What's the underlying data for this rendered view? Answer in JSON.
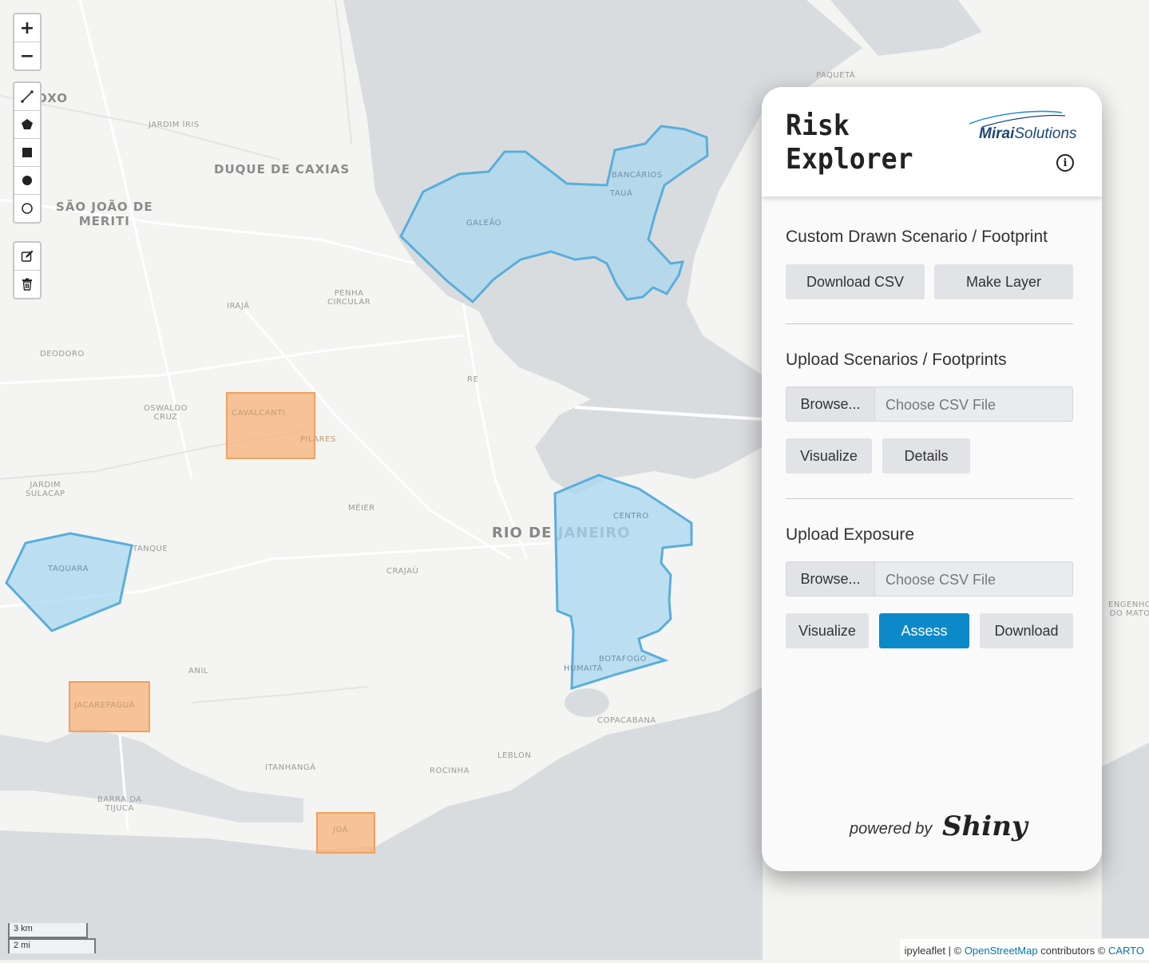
{
  "map": {
    "zoom_in": "+",
    "zoom_out": "−",
    "draw_tools": [
      "polyline-icon",
      "polygon-icon",
      "rectangle-icon",
      "circle-marker-icon",
      "circle-icon"
    ],
    "edit_tools": [
      "edit-icon",
      "trash-icon"
    ],
    "scale_km": "3 km",
    "scale_mi": "2 mi",
    "attribution": {
      "prefix": "ipyleaflet",
      "sep": "|",
      "copy1": "©",
      "osm": "OpenStreetMap",
      "contributors": "contributors ©",
      "carto": "CARTO"
    },
    "places": {
      "paqueta": "PAQUETÁ",
      "jardim_iris": "JARDIM ÍRIS",
      "duque": "DUQUE DE CAXIAS",
      "sjm": "SÃO JOÃO DE\nMERITI",
      "galeao": "GALEÃO",
      "bancarios": "BANCÁRIOS",
      "taua": "TAUÁ",
      "iraja": "IRAJÁ",
      "penha": "PENHA\nCIRCULAR",
      "deodoro": "DEODORO",
      "oswaldo": "OSWALDO\nCRUZ",
      "cavalcanti": "CAVALCANTI",
      "pilares": "PILARES",
      "re": "RE",
      "jardim_sulacap": "JARDIM\nSULACAP",
      "meier": "MÉIER",
      "rio": "RIO DE JANEIRO",
      "centro": "CENTRO",
      "tanque": "TANQUE",
      "taquara": "TAQUARA",
      "jacarepagua": "JACAREPAGUÁ",
      "anil": "ANIL",
      "crajau": "CRAJAÚ",
      "botafogo": "BOTAFOGO",
      "humaita": "HUMAITÁ",
      "copacabana": "COPACABANA",
      "leblon": "LEBLON",
      "itanhanga": "ITANHANGÁ",
      "rocinha": "ROCINHA",
      "barra": "BARRA DA\nTIJUCA",
      "joa": "JOÁ",
      "engenho": "ENGENHO\nDO MATO",
      "oxo": "OXO"
    }
  },
  "panel": {
    "title": "Risk\nExplorer",
    "logo": {
      "brand": "Mirai",
      "suffix": "Solutions"
    },
    "info": "i",
    "section1": {
      "title": "Custom Drawn Scenario / Footprint",
      "download_csv": "Download CSV",
      "make_layer": "Make Layer"
    },
    "section2": {
      "title": "Upload Scenarios / Footprints",
      "browse": "Browse...",
      "placeholder": "Choose CSV File",
      "visualize": "Visualize",
      "details": "Details"
    },
    "section3": {
      "title": "Upload Exposure",
      "browse": "Browse...",
      "placeholder": "Choose CSV File",
      "visualize": "Visualize",
      "assess": "Assess",
      "download": "Download"
    },
    "powered_by": "powered by",
    "shiny": "Shiny"
  },
  "colors": {
    "polygon_fill": "#a8d8ef",
    "polygon_stroke": "#5aaedb",
    "rect_fill": "#f7b27a",
    "rect_stroke": "#f0a05e",
    "accent": "#0c89c8"
  }
}
